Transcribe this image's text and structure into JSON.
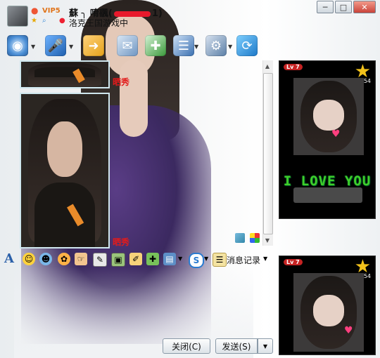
{
  "window": {
    "title": "蘇 ╮ 唷颻(",
    "title_suffix": "1)",
    "status": "洛克王国游戏中",
    "vip_badge": "VIP5",
    "minimize": "─",
    "maximize": "□",
    "close": "✕"
  },
  "toolbar": {
    "items": [
      {
        "icon": "webcam-icon",
        "has_dropdown": true
      },
      {
        "icon": "microphone-icon",
        "has_dropdown": true
      },
      {
        "icon": "folder-transfer-icon",
        "has_dropdown": false
      },
      {
        "icon": "mail-icon",
        "has_dropdown": false
      },
      {
        "icon": "add-app-icon",
        "has_dropdown": false
      },
      {
        "icon": "user-card-icon",
        "has_dropdown": true
      },
      {
        "icon": "settings-icon",
        "has_dropdown": true
      },
      {
        "icon": "share-icon",
        "has_dropdown": false
      }
    ]
  },
  "chat": {
    "captions": [
      "晒秀",
      "晒秀"
    ]
  },
  "format_bar": {
    "font_label": "A",
    "history_label": "消息记录",
    "icons": [
      "font-icon",
      "emoji-icon",
      "magic-face-icon",
      "smile-icon",
      "hand-icon",
      "screen-capture-icon",
      "image-icon",
      "doodle-icon",
      "gift-icon",
      "screenshot-icon",
      "money-icon",
      "history-icon"
    ]
  },
  "side_panels": {
    "level_label": "Lv 7",
    "star_count": "54",
    "love_text": "I LOVE YOU"
  },
  "buttons": {
    "close_label": "关闭(C)",
    "send_label": "发送(S)",
    "send_dropdown": "▼"
  },
  "colors": {
    "caption": "#e21b1b",
    "love_text": "#3fcf2a",
    "star": "#f3c21b"
  }
}
